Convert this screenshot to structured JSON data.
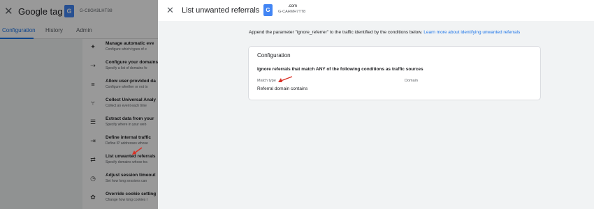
{
  "background": {
    "close_icon": "close-icon",
    "title": "Google tag",
    "tag_id": "G-C8GK8LHT88",
    "tabs": [
      {
        "label": "Configuration"
      },
      {
        "label": "History"
      },
      {
        "label": "Admin"
      }
    ],
    "items": [
      {
        "icon": "sparkle-icon",
        "title": "Manage automatic eve",
        "desc": "Configure which types of e"
      },
      {
        "icon": "link-icon",
        "title": "Configure your domains",
        "desc": "Specify a list of domains fo"
      },
      {
        "icon": "data-icon",
        "title": "Allow user-provided da",
        "desc": "Configure whether or not to"
      },
      {
        "icon": "fork-icon",
        "title": "Collect Universal Analy",
        "desc": "Collect an event each time"
      },
      {
        "icon": "extract-icon",
        "title": "Extract data from your",
        "desc": "Specify where in your web"
      },
      {
        "icon": "enter-icon",
        "title": "Define internal traffic",
        "desc": "Define IP addresses whose"
      },
      {
        "icon": "filter-icon",
        "title": "List unwanted referrals",
        "desc": "Specify domains whose tra"
      },
      {
        "icon": "clock-icon",
        "title": "Adjust session timeout",
        "desc": "Set how long sessions can"
      },
      {
        "icon": "cookie-icon",
        "title": "Override cookie setting",
        "desc": "Change how long cookies l"
      }
    ]
  },
  "panel": {
    "close_icon": "close-icon",
    "title": "List unwanted referrals",
    "site": ".com",
    "tag_id": "G-CAHMH7TT8",
    "intro": "Append the parameter \"ignore_referrer\" to the traffic identified by the conditions below.",
    "learn_more": "Learn more about identifying unwanted referrals",
    "card": {
      "title": "Configuration",
      "description": "Ignore referrals that match ANY of the following conditions as traffic sources",
      "col_match_type": "Match type",
      "col_domain": "Domain",
      "condition": "Referral domain contains"
    }
  },
  "colors": {
    "accent": "#1a73e8",
    "annotation_arrow": "#d93025"
  }
}
